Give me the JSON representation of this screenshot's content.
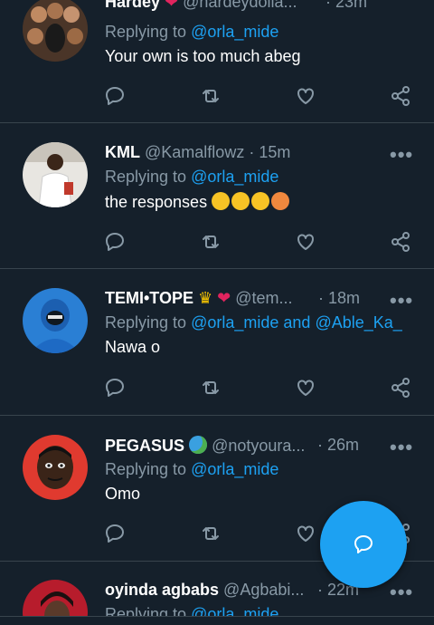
{
  "tweets": [
    {
      "name": "Hardey",
      "handle": "@hardeydolla...",
      "time": "· 23m",
      "replying_prefix": "Replying to",
      "replying_to": "@orla_mide",
      "text": "Your own is too much abeg"
    },
    {
      "name": "KML",
      "handle": "@Kamalflowz",
      "time": "· 15m",
      "replying_prefix": "Replying to",
      "replying_to": "@orla_mide",
      "text": "the responses"
    },
    {
      "name": "TEMI•TOPE",
      "handle": "@tem...",
      "time": "· 18m",
      "replying_prefix": "Replying to",
      "replying_to": "@orla_mide",
      "replying_and": "and",
      "replying_to_2": "@Able_Ka_",
      "text": "Nawa o"
    },
    {
      "name": "PEGASUS",
      "handle": "@notyoura...",
      "time": "· 26m",
      "replying_prefix": "Replying to",
      "replying_to": "@orla_mide",
      "text": "Omo"
    },
    {
      "name": "oyinda agbabs",
      "handle": "@Agbabi...",
      "time": "· 22m",
      "replying_prefix": "Replying to",
      "replying_to": "@orla_mide"
    }
  ],
  "more_glyph": "•••",
  "colors": {
    "background": "#15202b",
    "accent": "#1da1f2",
    "muted": "#8899a6",
    "divider": "#38444d",
    "heart": "#e0245e"
  },
  "icons": [
    "reply-icon",
    "retweet-icon",
    "like-icon",
    "share-icon",
    "compose-reply-icon"
  ]
}
